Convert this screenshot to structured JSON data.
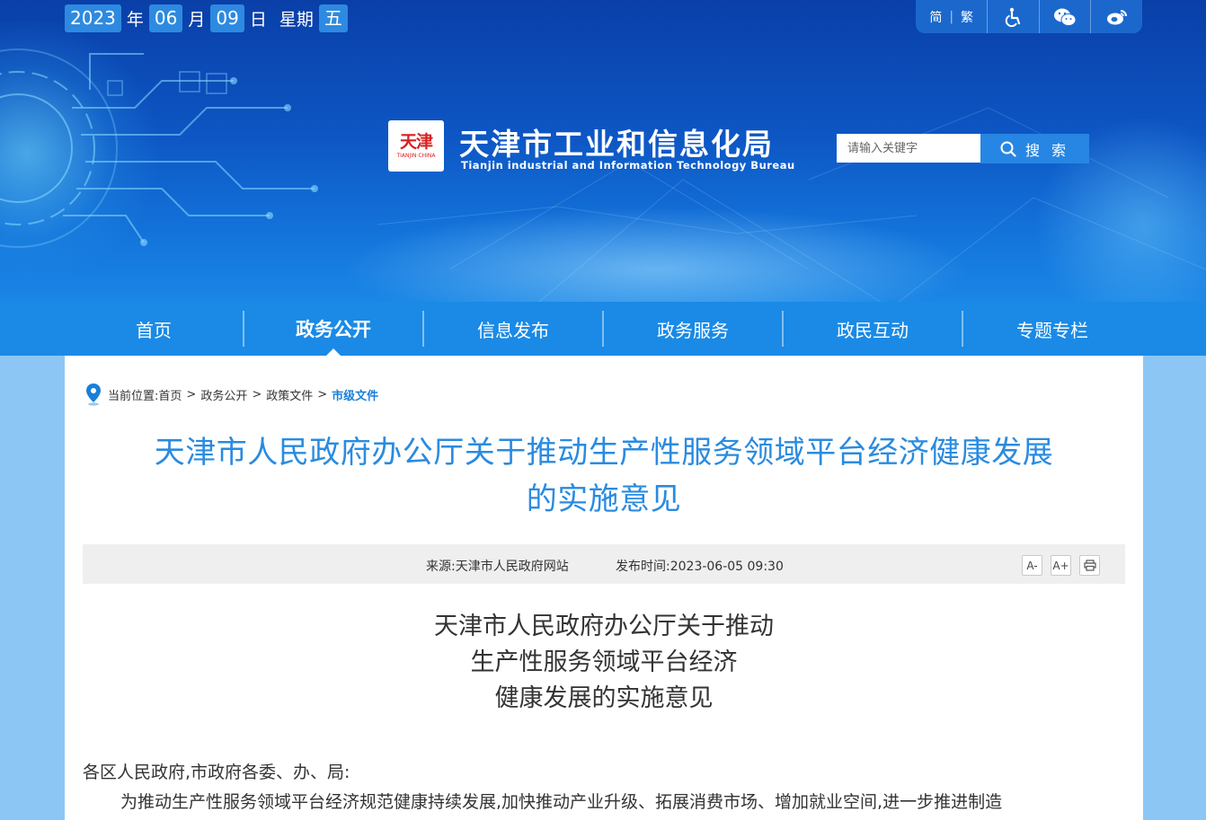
{
  "date": {
    "year": "2023",
    "year_label": "年",
    "month": "06",
    "month_label": "月",
    "day": "09",
    "day_label": "日",
    "weekday_label": "星期",
    "weekday": "五"
  },
  "tools": {
    "simplified": "简",
    "traditional": "繁"
  },
  "site": {
    "seal_chars": "天津",
    "seal_sub": "TIANJIN·CHINA",
    "title": "天津市工业和信息化局",
    "subtitle": "Tianjin industrial and Information Technology Bureau"
  },
  "search": {
    "placeholder": "请输入关键字",
    "button_label": "搜 索"
  },
  "nav": {
    "items": [
      {
        "label": "首页"
      },
      {
        "label": "政务公开"
      },
      {
        "label": "信息发布"
      },
      {
        "label": "政务服务"
      },
      {
        "label": "政民互动"
      },
      {
        "label": "专题专栏"
      }
    ]
  },
  "breadcrumb": {
    "prefix": "当前位置:",
    "items": [
      "首页",
      "政务公开",
      "政策文件"
    ],
    "current": "市级文件",
    "separator": ">"
  },
  "article": {
    "title_line1": "天津市人民政府办公厅关于推动生产性服务领域平台经济健康发展",
    "title_line2": "的实施意见",
    "source": "来源:天津市人民政府网站",
    "publish_time": "发布时间:2023-06-05 09:30",
    "font_smaller": "A-",
    "font_larger": "A+",
    "doc_title_line1": "天津市人民政府办公厅关于推动",
    "doc_title_line2": "生产性服务领域平台经济",
    "doc_title_line3": "健康发展的实施意见",
    "salutation": "各区人民政府,市政府各委、办、局:",
    "paragraph1": "为推动生产性服务领域平台经济规范健康持续发展,加快推动产业升级、拓展消费市场、增加就业空间,进一步推进制造"
  },
  "colors": {
    "nav_bg": "#1a8ae6",
    "title_blue": "#2a8be0",
    "page_bg": "#8cc6f5",
    "seal_red": "#d82020"
  }
}
